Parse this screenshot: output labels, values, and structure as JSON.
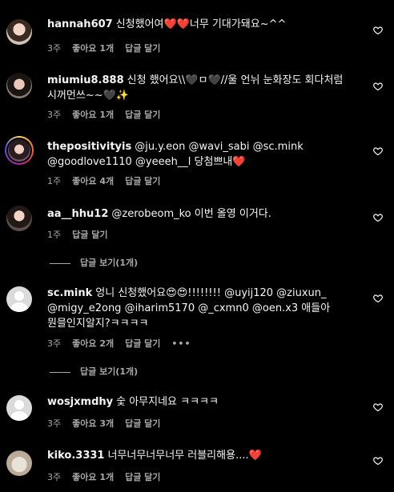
{
  "comments": [
    {
      "username": "hannah607",
      "text": "신청했어여❤️❤️너무 기대가돼요~^^",
      "time": "3주",
      "likes": "좋아요 1개",
      "reply": "답글 달기"
    },
    {
      "username": "miumiu8.888",
      "text": "신청 했어요\\\\🖤ㅁ🖤//울 언뉘 눈화장도 회다처럼 시꺼먼쓰~~🖤✨",
      "time": "3주",
      "likes": "좋아요 1개",
      "reply": "답글 달기"
    },
    {
      "username": "thepositivityis",
      "text": "@ju.y.eon @wavi_sabi @sc.mink @goodlove1110 @yeeeh__l 당첨쁘내❤️",
      "time": "1주",
      "likes": "좋아요 4개",
      "reply": "답글 달기"
    },
    {
      "username": "aa__hhu12",
      "text": "@zerobeom_ko 이번 올영 이거다.",
      "time": "1주",
      "reply": "답글 달기",
      "view_replies": "답글 보기(1개)"
    },
    {
      "username": "sc.mink",
      "text": "엉니 신청했어요😍😍!!!!!!!! @uyij120 @ziuxun_ @migy_e2ong @iharim5170 @_cxmn0 @oen.x3 애들아 뭔믈인지알지?ㅋㅋㅋㅋ",
      "time": "3주",
      "likes": "좋아요 2개",
      "reply": "답글 달기",
      "more": "•••",
      "view_replies": "답글 보기(1개)"
    },
    {
      "username": "wosjxmdhy",
      "text": "숯 아무지네요 ㅋㅋㅋㅋ",
      "time": "3주",
      "likes": "좋아요 3개",
      "reply": "답글 달기"
    },
    {
      "username": "kiko.3331",
      "text": "너무너무너무너무 러블리해용....❤️",
      "time": "3주",
      "likes": "좋아요 1개",
      "reply": "답글 달기"
    }
  ]
}
